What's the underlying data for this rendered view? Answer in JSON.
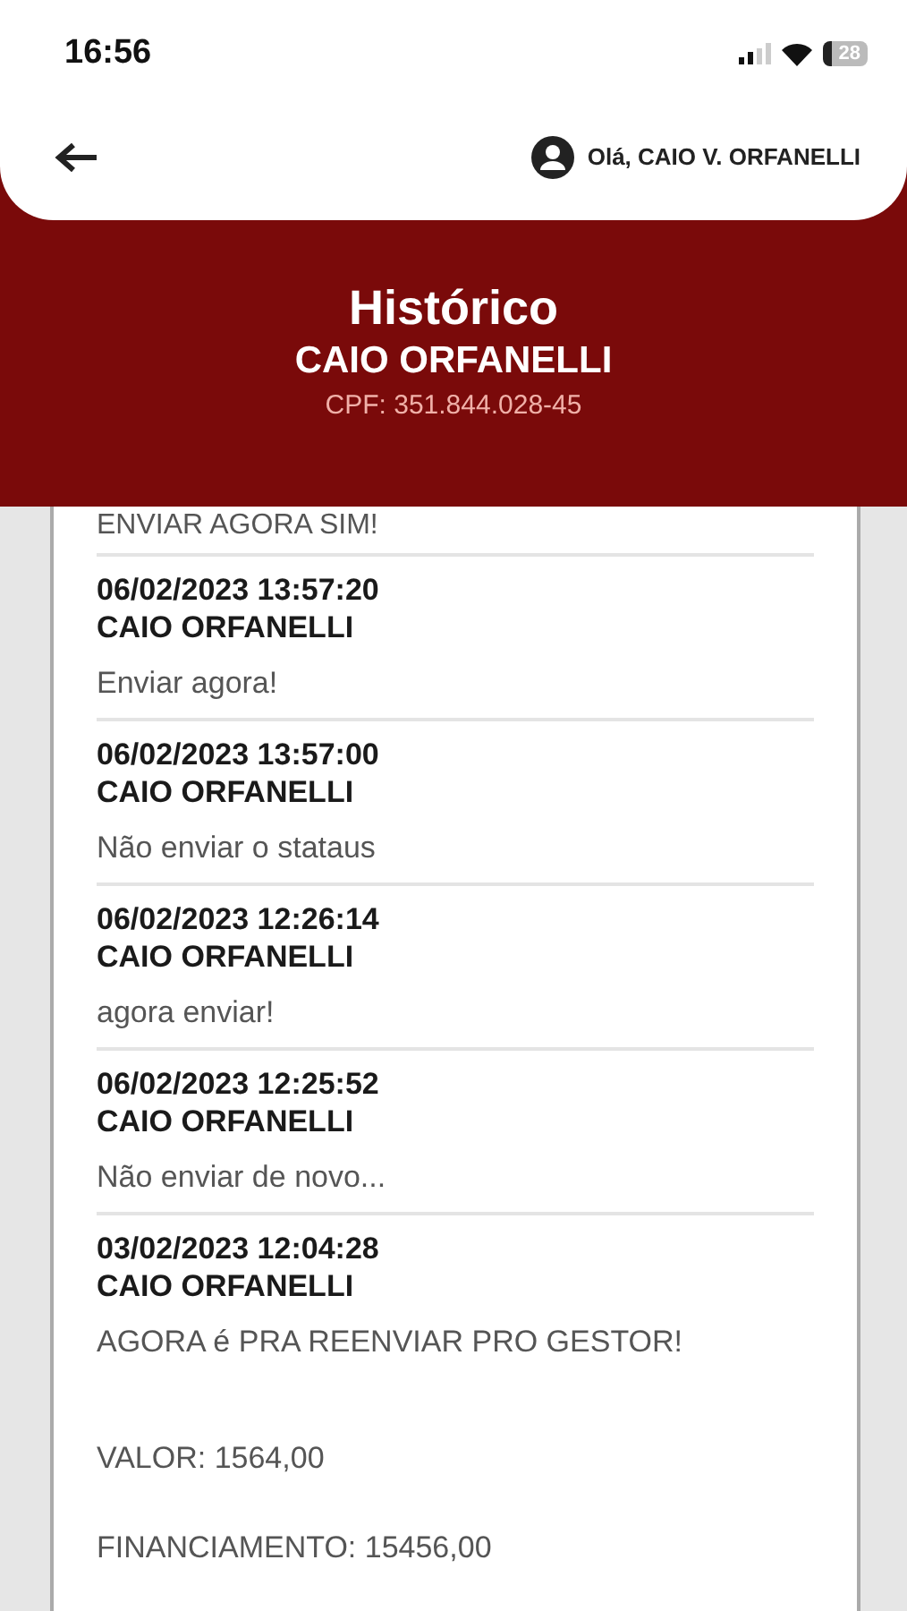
{
  "status_bar": {
    "time": "16:56",
    "battery": "28"
  },
  "header": {
    "greeting": "Olá, CAIO V. ORFANELLI"
  },
  "banner": {
    "title": "Histórico",
    "name": "CAIO ORFANELLI",
    "cpf": "CPF: 351.844.028-45"
  },
  "history": {
    "partial_message": "ENVIAR AGORA SIM!",
    "entries": [
      {
        "datetime": "06/02/2023 13:57:20",
        "name": "CAIO ORFANELLI",
        "message": "Enviar agora!"
      },
      {
        "datetime": "06/02/2023 13:57:00",
        "name": "CAIO ORFANELLI",
        "message": "Não enviar o stataus"
      },
      {
        "datetime": "06/02/2023 12:26:14",
        "name": "CAIO ORFANELLI",
        "message": "agora enviar!"
      },
      {
        "datetime": "06/02/2023 12:25:52",
        "name": "CAIO ORFANELLI",
        "message": "Não enviar de novo..."
      },
      {
        "datetime": "03/02/2023 12:04:28",
        "name": "CAIO ORFANELLI",
        "message": "AGORA é PRA REENVIAR PRO GESTOR!"
      }
    ],
    "details": [
      "VALOR: 1564,00",
      "FINANCIAMENTO: 15456,00"
    ]
  }
}
